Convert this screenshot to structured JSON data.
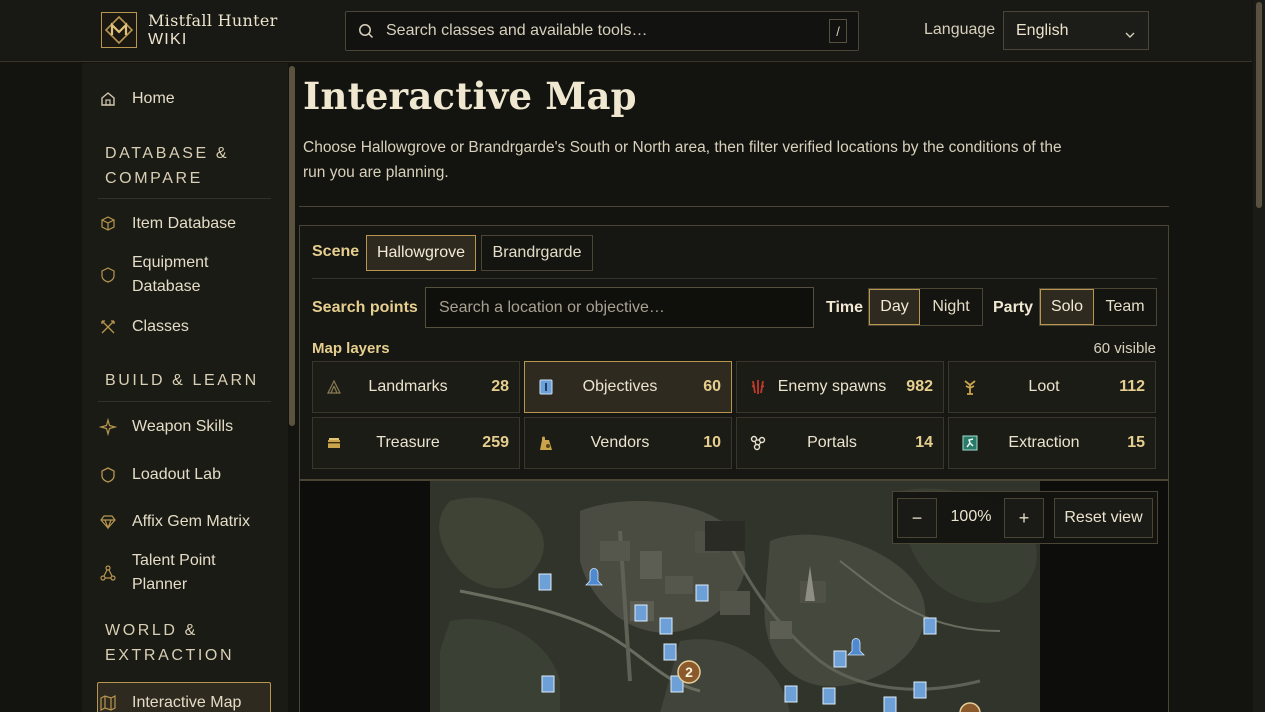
{
  "brand": {
    "title": "Mistfall Hunter",
    "subtitle": "WIKI",
    "accent": "#b89650"
  },
  "header": {
    "search_placeholder": "Search classes and available tools…",
    "search_shortcut": "/",
    "language_label": "Language",
    "language_value": "English"
  },
  "sidebar": {
    "home": "Home",
    "sections": [
      {
        "title": "DATABASE &\nCOMPARE",
        "items": [
          "Item Database",
          "Equipment Database",
          "Classes"
        ]
      },
      {
        "title": "BUILD & LEARN",
        "items": [
          "Weapon Skills",
          "Loadout Lab",
          "Affix Gem Matrix",
          "Talent Point Planner"
        ]
      },
      {
        "title": "WORLD &\nEXTRACTION",
        "items": [
          "Interactive Map"
        ]
      }
    ],
    "labels": {
      "database_head_1": "DATABASE &",
      "database_head_2": "COMPARE",
      "item_database": "Item Database",
      "equipment_1": "Equipment",
      "equipment_2": "Database",
      "classes": "Classes",
      "build_head": "BUILD & LEARN",
      "weapon_skills": "Weapon Skills",
      "loadout_lab": "Loadout Lab",
      "affix_gem_matrix": "Affix Gem Matrix",
      "talent_1": "Talent Point",
      "talent_2": "Planner",
      "world_head_1": "WORLD &",
      "world_head_2": "EXTRACTION",
      "interactive_map": "Interactive Map"
    }
  },
  "main": {
    "title": "Interactive Map",
    "description": "Choose Hallowgrove or Brandrgarde's South or North area, then filter verified locations by the conditions of the run you are planning."
  },
  "filters": {
    "scene_label": "Scene",
    "scenes": [
      "Hallowgrove",
      "Brandrgarde"
    ],
    "scene_selected": "Hallowgrove",
    "search_label": "Search points",
    "search_placeholder": "Search a location or objective…",
    "time_label": "Time",
    "time_options": [
      "Day",
      "Night"
    ],
    "time_selected": "Day",
    "party_label": "Party",
    "party_options": [
      "Solo",
      "Team"
    ],
    "party_selected": "Solo",
    "layers_label": "Map layers",
    "visible_text": "60 visible",
    "layers": [
      {
        "name": "Landmarks",
        "count": "28",
        "icon": "landmark-icon",
        "active": false
      },
      {
        "name": "Objectives",
        "count": "60",
        "icon": "objective-icon",
        "active": true
      },
      {
        "name": "Enemy spawns",
        "count": "982",
        "icon": "enemy-icon",
        "active": false
      },
      {
        "name": "Loot",
        "count": "112",
        "icon": "loot-icon",
        "active": false
      },
      {
        "name": "Treasure",
        "count": "259",
        "icon": "treasure-icon",
        "active": false
      },
      {
        "name": "Vendors",
        "count": "10",
        "icon": "vendor-icon",
        "active": false
      },
      {
        "name": "Portals",
        "count": "14",
        "icon": "portal-icon",
        "active": false
      },
      {
        "name": "Extraction",
        "count": "15",
        "icon": "extraction-icon",
        "active": false
      }
    ]
  },
  "map": {
    "zoom_out": "−",
    "zoom_level": "100%",
    "zoom_in": "+",
    "reset_label": "Reset view",
    "cluster_label": "2"
  }
}
